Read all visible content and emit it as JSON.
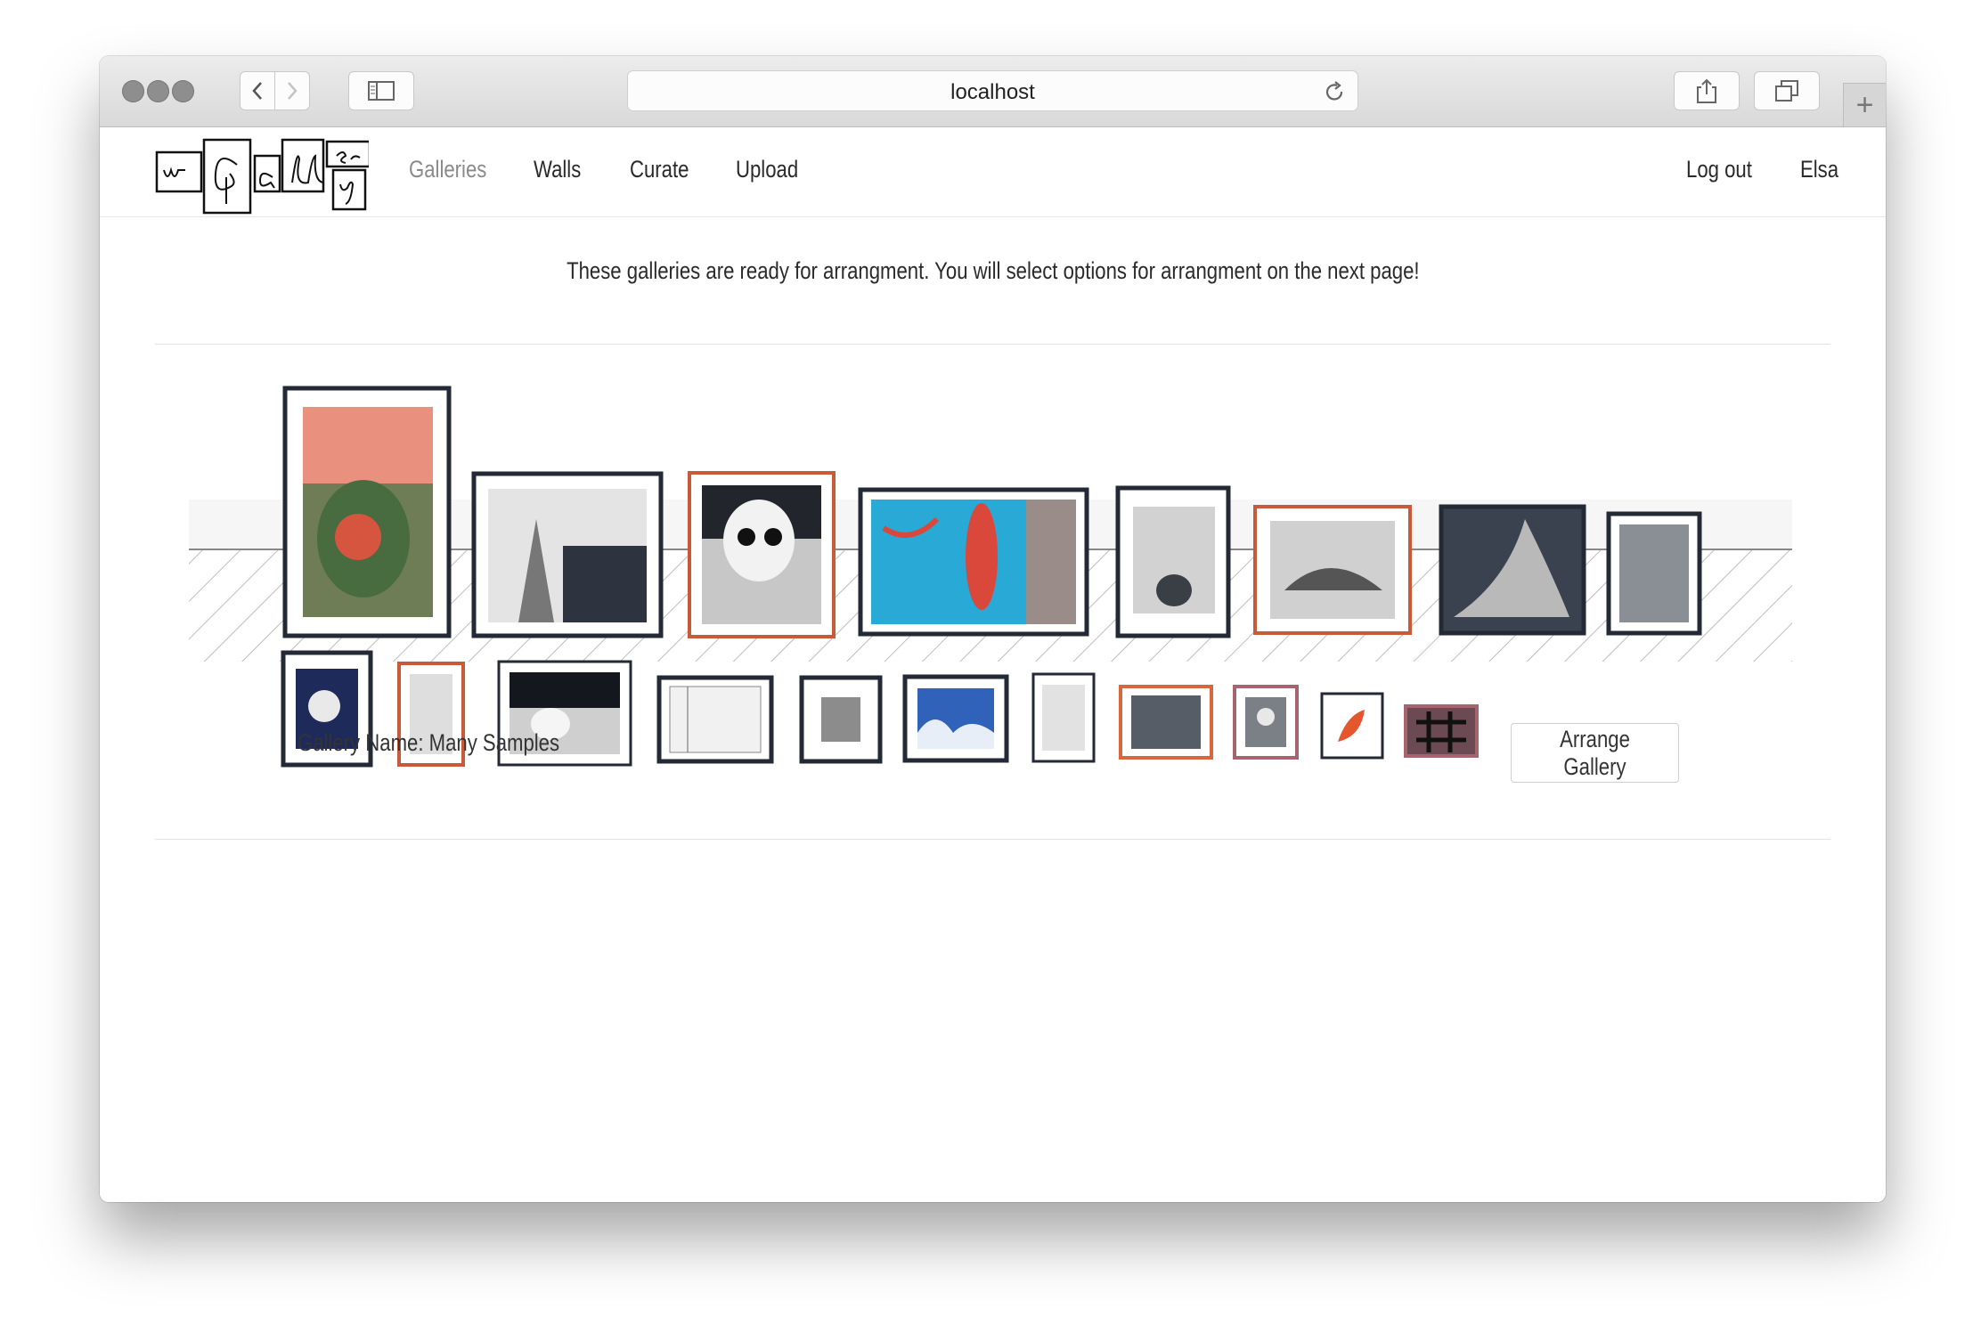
{
  "browser": {
    "url": "localhost"
  },
  "logo": {
    "letters": [
      "w",
      "G",
      "a",
      "ll",
      "er",
      "y"
    ]
  },
  "nav": {
    "galleries": "Galleries",
    "walls": "Walls",
    "curate": "Curate",
    "upload": "Upload",
    "logout": "Log out",
    "user": "Elsa"
  },
  "page": {
    "message": "These galleries are ready for arrangment. You will select options for arrangment on the next page!",
    "gallery_name": "Gallery Name: Many Samples",
    "arrange_button": "Arrange Gallery"
  },
  "colors": {
    "frame_dark": "#232a35",
    "frame_red": "#c85a3a",
    "frame_mauve": "#a5646e"
  }
}
